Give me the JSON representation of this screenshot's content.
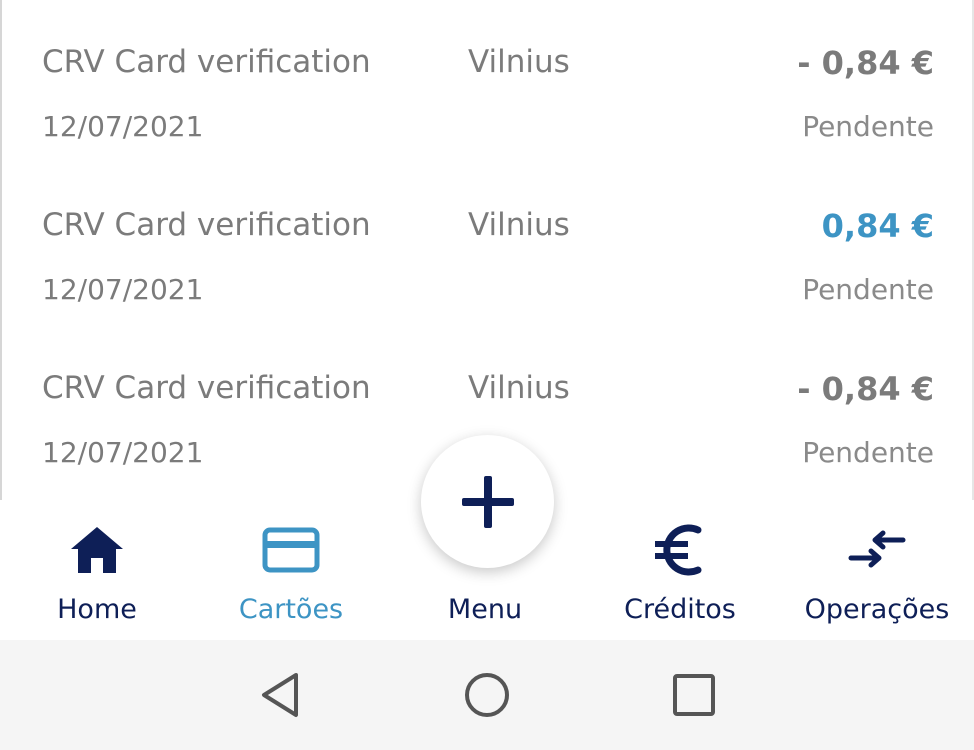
{
  "transactions": [
    {
      "description": "CRV Card verification",
      "city": "Vilnius",
      "amount": "- 0,84 €",
      "amount_kind": "debit",
      "date": "12/07/2021",
      "status": "Pendente"
    },
    {
      "description": "CRV Card verification",
      "city": "Vilnius",
      "amount": "0,84 €",
      "amount_kind": "credit",
      "date": "12/07/2021",
      "status": "Pendente"
    },
    {
      "description": "CRV Card verification",
      "city": "Vilnius",
      "amount": "- 0,84 €",
      "amount_kind": "debit",
      "date": "12/07/2021",
      "status": "Pendente"
    }
  ],
  "nav": {
    "items": [
      {
        "label": "Home",
        "icon": "home-icon"
      },
      {
        "label": "Cartões",
        "icon": "card-icon",
        "active": true
      },
      {
        "label": "Menu",
        "icon": "plus-icon"
      },
      {
        "label": "Créditos",
        "icon": "euro-icon"
      },
      {
        "label": "Operações",
        "icon": "transfer-arrows-icon"
      }
    ]
  },
  "system_nav": {
    "icons": [
      "back-triangle-icon",
      "home-circle-icon",
      "recents-square-icon"
    ]
  },
  "colors": {
    "navy": "#0e1f57",
    "accent_blue": "#3d94c4",
    "text_gray": "#7b7b7b"
  }
}
